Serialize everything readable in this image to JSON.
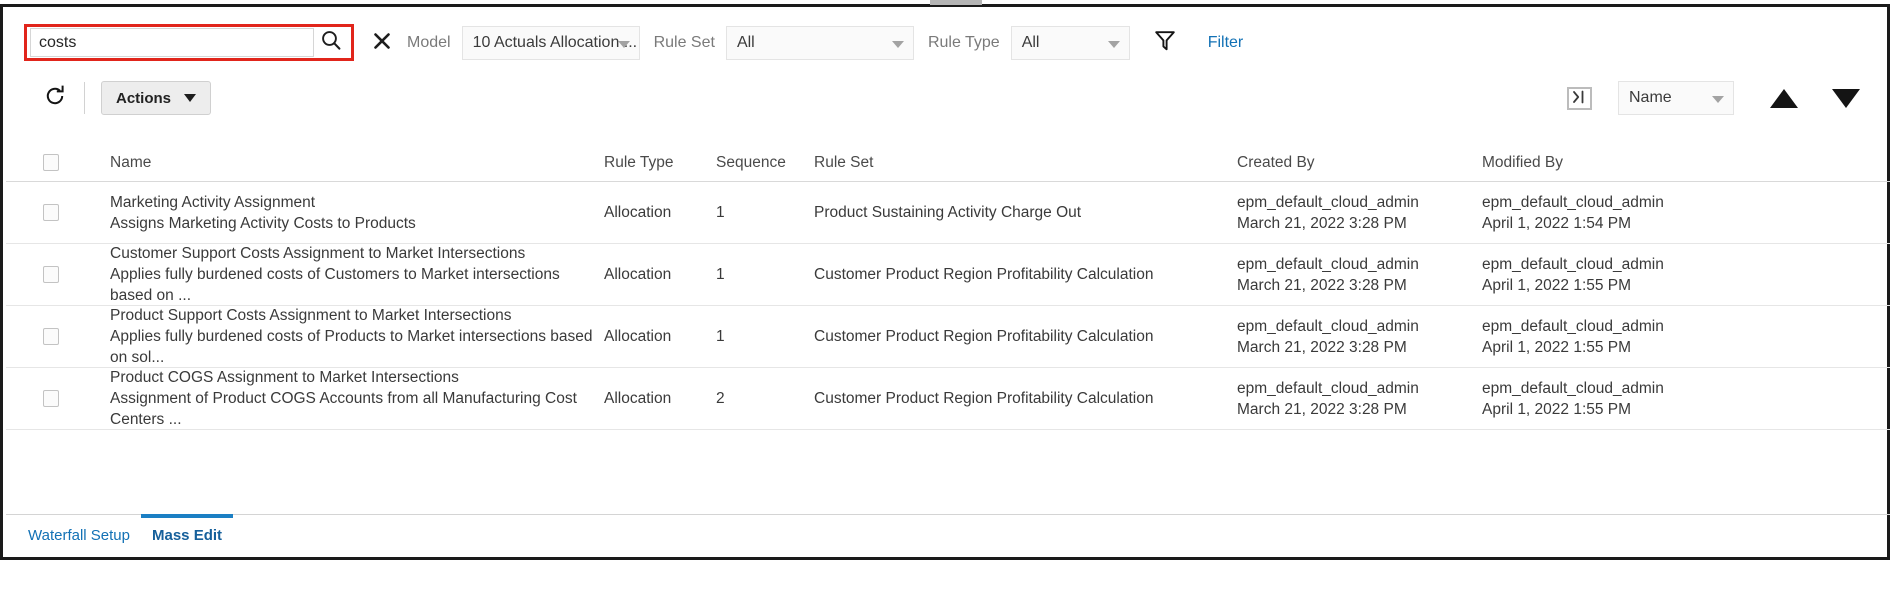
{
  "toolbar": {
    "search": {
      "value": "costs",
      "placeholder": "Search",
      "icon": "search-icon",
      "highlight_color": "#e1251b"
    },
    "clear_icon": "close-icon",
    "model_label": "Model",
    "model_value": "10 Actuals Allocation ...",
    "rule_set_label": "Rule Set",
    "rule_set_value": "All",
    "rule_type_label": "Rule Type",
    "rule_type_value": "All",
    "funnel_icon": "filter-funnel-icon",
    "filter_link": "Filter",
    "filter_link_color": "#1271b5"
  },
  "actionbar": {
    "refresh_icon": "refresh-icon",
    "actions_label": "Actions",
    "panel_toggle_icon": "expand-panel-icon",
    "sort_value": "Name",
    "sort_asc_icon": "triangle-up-icon",
    "sort_desc_icon": "triangle-down-icon"
  },
  "table": {
    "columns": [
      "Name",
      "Rule Type",
      "Sequence",
      "Rule Set",
      "Created By",
      "Modified By"
    ],
    "rows": [
      {
        "name": "Marketing Activity Assignment",
        "description": "Assigns Marketing Activity Costs to Products",
        "rule_type": "Allocation",
        "sequence": "1",
        "rule_set": "Product Sustaining Activity Charge Out",
        "created_by": "epm_default_cloud_admin",
        "created_on": "March 21, 2022 3:28 PM",
        "modified_by": "epm_default_cloud_admin",
        "modified_on": "April 1, 2022 1:54 PM"
      },
      {
        "name": "Customer Support Costs Assignment to Market Intersections",
        "description": "Applies fully burdened costs of Customers to Market intersections based on ...",
        "rule_type": "Allocation",
        "sequence": "1",
        "rule_set": "Customer Product Region Profitability Calculation",
        "created_by": "epm_default_cloud_admin",
        "created_on": "March 21, 2022 3:28 PM",
        "modified_by": "epm_default_cloud_admin",
        "modified_on": "April 1, 2022 1:55 PM"
      },
      {
        "name": "Product Support Costs Assignment to Market Intersections",
        "description": "Applies fully burdened costs of Products to Market intersections based on sol...",
        "rule_type": "Allocation",
        "sequence": "1",
        "rule_set": "Customer Product Region Profitability Calculation",
        "created_by": "epm_default_cloud_admin",
        "created_on": "March 21, 2022 3:28 PM",
        "modified_by": "epm_default_cloud_admin",
        "modified_on": "April 1, 2022 1:55 PM"
      },
      {
        "name": "Product COGS Assignment to Market Intersections",
        "description": "Assignment of Product COGS Accounts from all Manufacturing Cost Centers ...",
        "rule_type": "Allocation",
        "sequence": "2",
        "rule_set": "Customer Product Region Profitability Calculation",
        "created_by": "epm_default_cloud_admin",
        "created_on": "March 21, 2022 3:28 PM",
        "modified_by": "epm_default_cloud_admin",
        "modified_on": "April 1, 2022 1:55 PM"
      }
    ]
  },
  "tabs": [
    {
      "label": "Waterfall Setup",
      "active": false
    },
    {
      "label": "Mass Edit",
      "active": true
    }
  ]
}
